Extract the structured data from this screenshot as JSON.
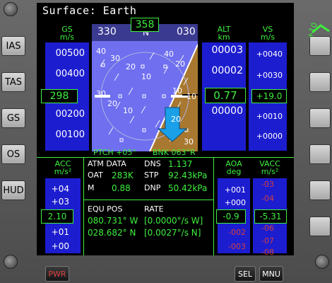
{
  "title": "Surface: Earth",
  "left_buttons": [
    "IAS",
    "TAS",
    "GS",
    "OS",
    "HUD"
  ],
  "colors": {
    "accent": "#3ef03e",
    "tape": "#1d1dd0",
    "sky": "#7070f0",
    "ground": "#a87830",
    "arrow": "#1aa0e8",
    "amber": "#e8a000",
    "red_text": "#d04040"
  },
  "gs_tape": {
    "label": "GS",
    "unit": "m/s",
    "ticks": [
      "00500",
      "00400",
      "00200",
      "00100"
    ],
    "readout": "298"
  },
  "heading": {
    "left": "330",
    "mid": "N",
    "right": "030",
    "readout": "358"
  },
  "attitude": {
    "pitch_labels": [
      "40",
      "30",
      "20",
      "10",
      "10",
      "20",
      "30",
      "40",
      "20",
      "10",
      "10",
      "20",
      "30"
    ],
    "pitch_text": "PTCH +05°",
    "bank_text": "BNK 063°R"
  },
  "alt_tape": {
    "label": "ALT",
    "unit": "km",
    "ticks": [
      "00003",
      "00002",
      "00000"
    ],
    "readout": "0.77"
  },
  "vs_tape": {
    "label": "VS",
    "unit": "m/s",
    "ticks": [
      "+0040",
      "+0030",
      "+0010",
      "+0000"
    ],
    "readout": "+19.0"
  },
  "acc_tape": {
    "label": "ACC",
    "unit": "m/s²",
    "ticks": [
      "+04",
      "+03",
      "+01",
      "+00"
    ],
    "readout": "2.10"
  },
  "atm": {
    "header": "ATM DATA",
    "oat_label": "OAT",
    "oat": "283K",
    "m_label": "M",
    "m": "0.88",
    "dns_label": "DNS",
    "dns": "1.137",
    "stp_label": "STP",
    "stp": "92.43kPa",
    "dnp_label": "DNP",
    "dnp": "50.42kPa"
  },
  "pos": {
    "header": "EQU POS",
    "lon": "080.731° W",
    "lat": "028.682° N",
    "rate_header": "RATE",
    "rate_lon": "[0.0000°/s W]",
    "rate_lat": "[0.0027°/s N]"
  },
  "aoa_tape": {
    "label": "AOA",
    "unit": "deg",
    "ticks": [
      "+001",
      "+000",
      "-002",
      "-003"
    ],
    "readout": "-0.9"
  },
  "vacc_tape": {
    "label": "VACC",
    "unit": "m/s²",
    "ticks": [
      "-03",
      "-04",
      "-06",
      "-07",
      "-08"
    ],
    "readout": "-5.31"
  },
  "right_indicator": "+10",
  "bottom_buttons": {
    "pwr": "PWR",
    "sel": "SEL",
    "mnu": "MNU"
  }
}
